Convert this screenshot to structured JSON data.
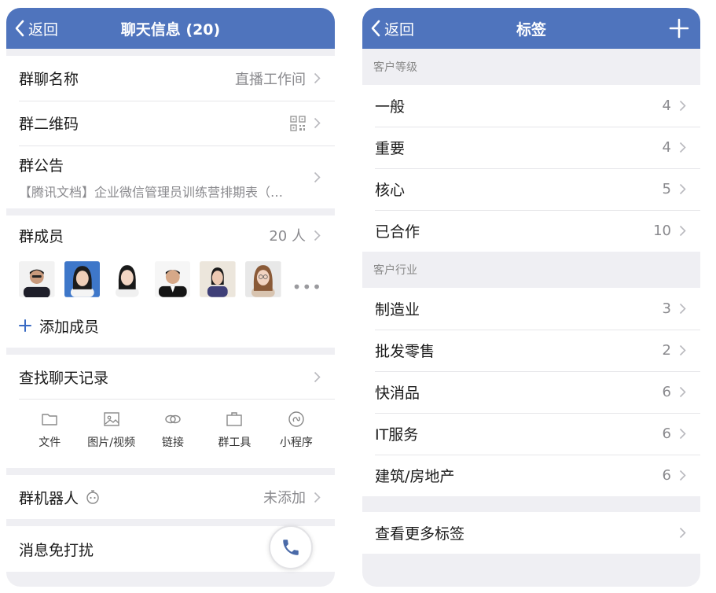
{
  "left": {
    "nav": {
      "back_label": "返回",
      "title": "聊天信息 (20)"
    },
    "group_name": {
      "label": "群聊名称",
      "value": "直播工作间"
    },
    "qr_code": {
      "label": "群二维码"
    },
    "announcement": {
      "label": "群公告",
      "preview": "【腾讯文档】企业微信管理员训练营排期表（…"
    },
    "members": {
      "label": "群成员",
      "count": "20 人",
      "more": "•••",
      "add_label": "添加成员"
    },
    "search_history": {
      "label": "查找聊天记录"
    },
    "tools": [
      {
        "label": "文件",
        "icon": "folder-icon"
      },
      {
        "label": "图片/视频",
        "icon": "image-icon"
      },
      {
        "label": "链接",
        "icon": "link-icon"
      },
      {
        "label": "群工具",
        "icon": "toolbox-icon"
      },
      {
        "label": "小程序",
        "icon": "mini-program-icon"
      }
    ],
    "robot": {
      "label": "群机器人",
      "value": "未添加"
    },
    "mute": {
      "label": "消息免打扰"
    }
  },
  "right": {
    "nav": {
      "back_label": "返回",
      "title": "标签"
    },
    "groups": [
      {
        "header": "客户等级",
        "items": [
          {
            "label": "一般",
            "count": "4"
          },
          {
            "label": "重要",
            "count": "4"
          },
          {
            "label": "核心",
            "count": "5"
          },
          {
            "label": "已合作",
            "count": "10"
          }
        ]
      },
      {
        "header": "客户行业",
        "items": [
          {
            "label": "制造业",
            "count": "3"
          },
          {
            "label": "批发零售",
            "count": "2"
          },
          {
            "label": "快消品",
            "count": "6"
          },
          {
            "label": "IT服务",
            "count": "6"
          },
          {
            "label": "建筑/房地产",
            "count": "6"
          }
        ]
      }
    ],
    "more_tags": "查看更多标签"
  },
  "colors": {
    "nav_blue": "#4f74bd",
    "background": "#efeff3",
    "accent_blue": "#3a6bc4"
  }
}
